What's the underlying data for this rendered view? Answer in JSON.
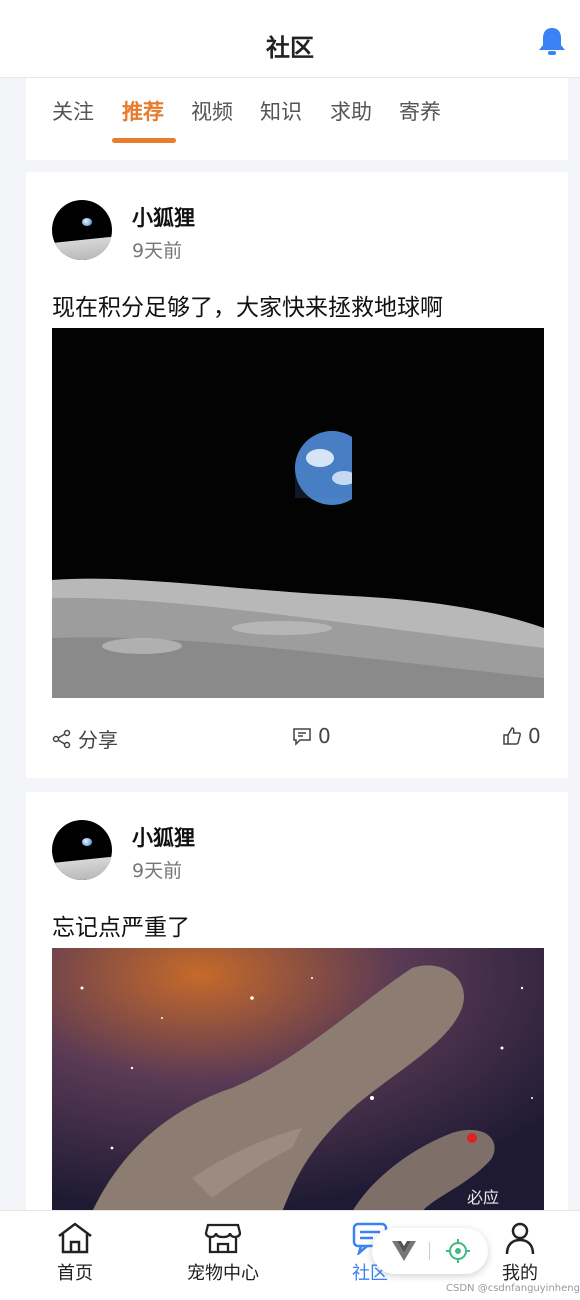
{
  "header": {
    "title": "社区",
    "bell_icon": "bell-icon"
  },
  "tabs": [
    {
      "label": "关注"
    },
    {
      "label": "推荐",
      "active": true
    },
    {
      "label": "视频"
    },
    {
      "label": "知识"
    },
    {
      "label": "求助"
    },
    {
      "label": "寄养"
    }
  ],
  "posts": [
    {
      "author": "小狐狸",
      "time": "9天前",
      "content": "现在积分足够了，大家快来拯救地球啊",
      "share_label": "分享",
      "comments": "0",
      "likes": "0",
      "image": "earth-rise-photo"
    },
    {
      "author": "小狐狸",
      "time": "9天前",
      "content": "忘记点严重了",
      "image": "nebula-pillars-photo",
      "image_watermark": "必应"
    }
  ],
  "bottom_nav": [
    {
      "label": "首页",
      "icon": "home-icon"
    },
    {
      "label": "宠物中心",
      "icon": "store-icon"
    },
    {
      "label": "社区",
      "icon": "community-icon",
      "active": true
    },
    {
      "label": "我的",
      "icon": "user-icon"
    }
  ],
  "watermark": "CSDN @csdnfanguyinheng",
  "colors": {
    "accent": "#e67c2d",
    "active_blue": "#3b82f6"
  }
}
